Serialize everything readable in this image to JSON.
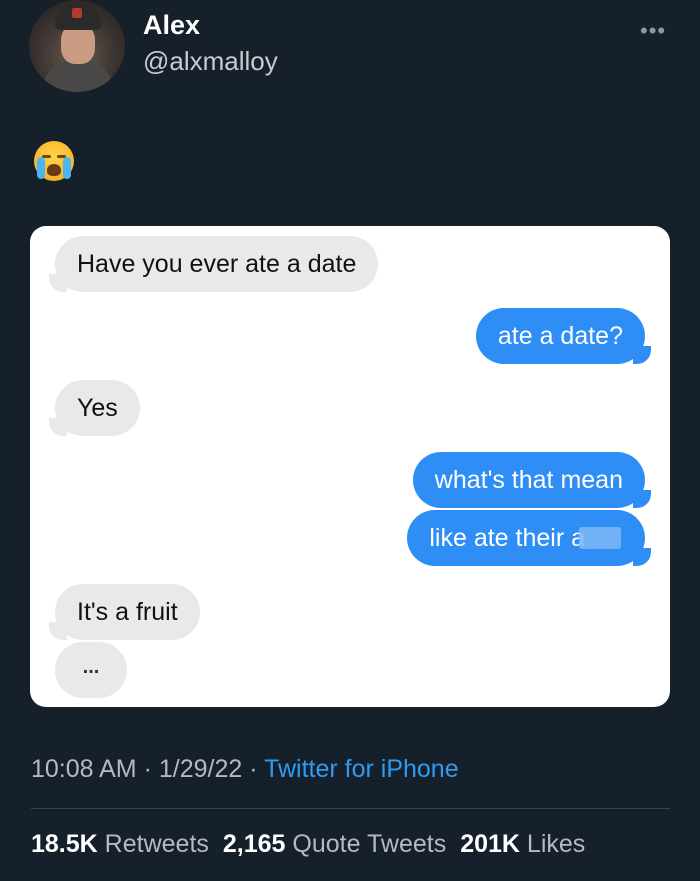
{
  "tweet": {
    "display_name": "Alex",
    "handle": "@alxmalloy",
    "more_icon": "more-horizontal-icon",
    "emoji": "loudly-crying-face-emoji",
    "time": "10:08 AM",
    "date": "1/29/22",
    "source": "Twitter for iPhone",
    "separator": "·",
    "colors": {
      "background": "#15202b",
      "link": "#2f9bf0",
      "imessage_blue": "#2f8ef5",
      "imessage_gray": "#e9e9eb"
    }
  },
  "conversation": {
    "messages": [
      {
        "from": "them",
        "text": "Have you ever ate a date"
      },
      {
        "from": "me",
        "text": "ate a date?"
      },
      {
        "from": "them",
        "text": "Yes"
      },
      {
        "from": "me",
        "text": "what's that mean"
      },
      {
        "from": "me",
        "text": "like ate their a"
      },
      {
        "from": "them",
        "text": "It's a fruit"
      }
    ],
    "typing_indicator": "..."
  },
  "stats": {
    "retweets_count": "18.5K",
    "retweets_label": "Retweets",
    "quotes_count": "2,165",
    "quotes_label": "Quote Tweets",
    "likes_count": "201K",
    "likes_label": "Likes"
  }
}
